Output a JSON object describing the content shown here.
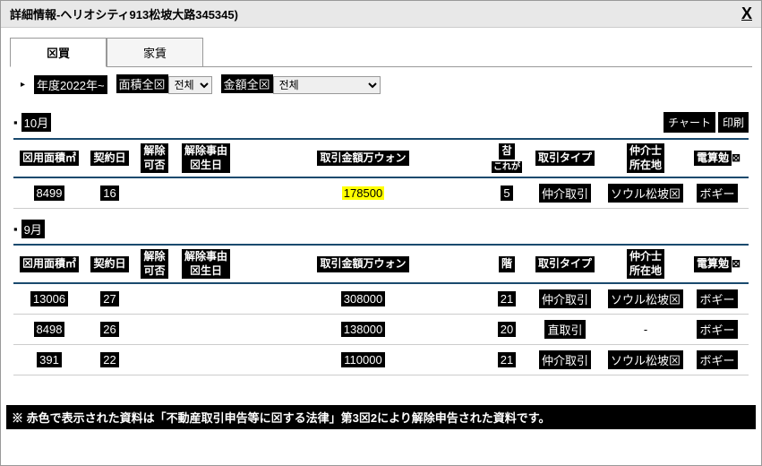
{
  "window": {
    "title": "詳細情報-ヘリオシティ913松坡大路345345)"
  },
  "close_label": "X",
  "tabs": {
    "buy": "⊠買",
    "rent": "家賃"
  },
  "filters": {
    "year_label": "年度2022年~",
    "area_label": "面積全⊠",
    "area_sel": "전체",
    "amount_label": "金額全⊠",
    "amount_sel": "전체"
  },
  "buttons": {
    "chart": "チャート",
    "print": "印刷"
  },
  "columns": {
    "area": "⊠用面積㎡",
    "date": "契約日",
    "cancel": "解除\n可否",
    "cancel_date": "解除事由\n⊠生日",
    "price": "取引金額万ウォン",
    "note_top": "참",
    "note_tag": "これが",
    "floor": "階",
    "type_pre": "取引",
    "type_bold": "タイプ",
    "broker": "仲介士\n所在地",
    "comp_pre": "電算勉",
    "comp_suf": "⊠"
  },
  "months": {
    "oct": {
      "label": "10月"
    },
    "sep": {
      "label": "9月"
    }
  },
  "rows": {
    "oct": [
      {
        "area": "8499",
        "date": "16",
        "cancel": "",
        "cancel_date": "",
        "price": "178500",
        "highlight": true,
        "floor": "5",
        "type": "仲介取引",
        "broker": "ソウル松坡⊠",
        "comp": "ボギー"
      }
    ],
    "sep": [
      {
        "area": "13006",
        "date": "27",
        "cancel": "",
        "cancel_date": "",
        "price": "308000",
        "floor": "21",
        "type": "仲介取引",
        "broker": "ソウル松坡⊠",
        "comp": "ボギー"
      },
      {
        "area": "8498",
        "date": "26",
        "cancel": "",
        "cancel_date": "",
        "price": "138000",
        "floor": "20",
        "type": "直取引",
        "broker": "-",
        "comp": "ボギー"
      },
      {
        "area": "391",
        "date": "22",
        "cancel": "",
        "cancel_date": "",
        "price": "110000",
        "floor": "21",
        "type": "仲介取引",
        "broker": "ソウル松坡⊠",
        "comp": "ボギー"
      }
    ]
  },
  "footer": "※ 赤色で表示された資料は「不動産取引申告等に⊠する法律」第3⊠2により解除申告された資料です。"
}
